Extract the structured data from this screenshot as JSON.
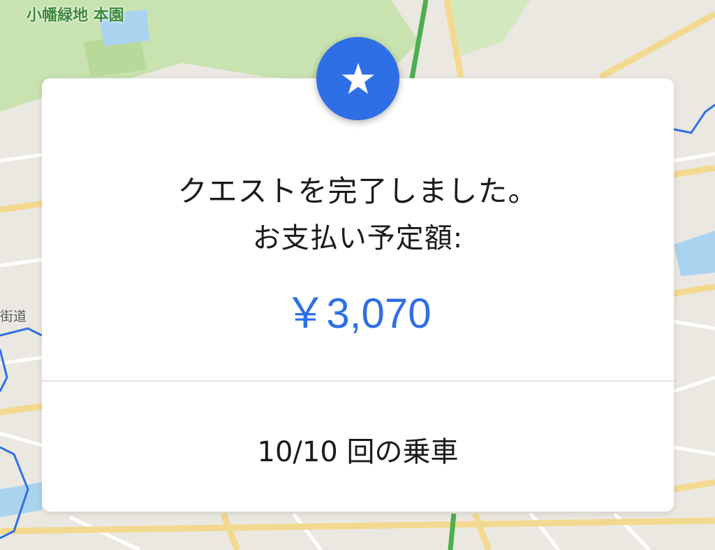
{
  "map": {
    "park_label": "小幡緑地 本園",
    "road_label": "街道",
    "colors": {
      "land": "#ebe8e1",
      "park": "#c8e2b0",
      "road": "#ffffff",
      "major_road": "#f3d98f",
      "water": "#aad3f0",
      "route": "#2f6fe6",
      "rail": "#4caf50"
    }
  },
  "quest": {
    "icon": "star-icon",
    "message_line1": "クエストを完了しました。",
    "message_line2": "お支払い予定額:",
    "amount": "￥3,070",
    "rides_summary": "10/10 回の乗車",
    "accent_color": "#2f6fe6"
  }
}
